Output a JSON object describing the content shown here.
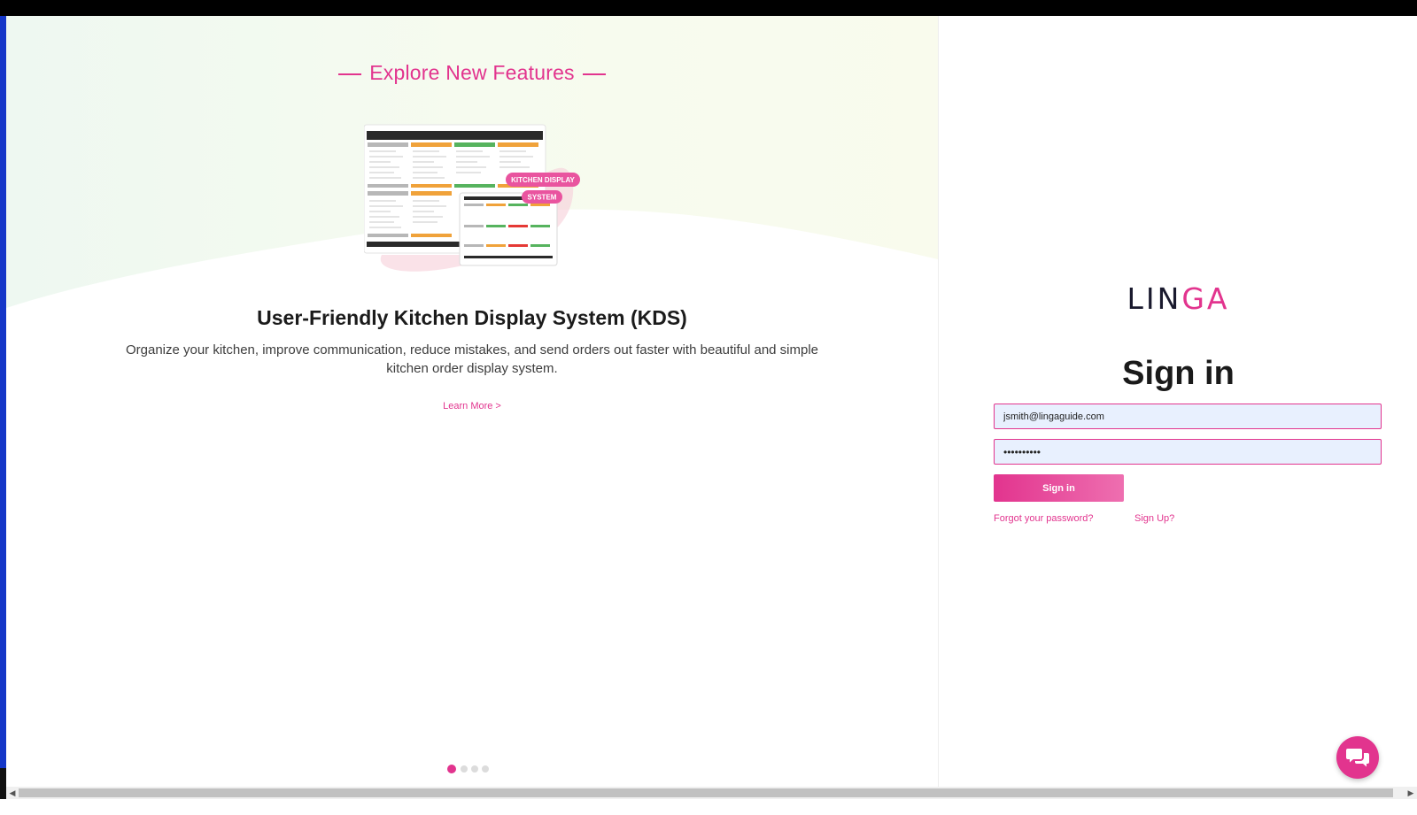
{
  "promo": {
    "section_heading": "Explore New Features",
    "image_badge_1": "KITCHEN DISPLAY",
    "image_badge_2": "SYSTEM",
    "title": "User-Friendly Kitchen Display System (KDS)",
    "description": "Organize your kitchen, improve communication, reduce mistakes, and send orders out faster with beautiful and simple kitchen order display system.",
    "learn_more": "Learn More >",
    "carousel": {
      "slide_count": 4,
      "active_index": 0
    }
  },
  "login": {
    "logo_main": "LIN",
    "logo_accent": "GA",
    "title": "Sign in",
    "email_value": "jsmith@lingaguide.com",
    "password_value": "••••••••••",
    "submit_label": "Sign in",
    "forgot_password": "Forgot your password?",
    "sign_up": "Sign Up?"
  },
  "icons": {
    "chat": "chat-bubbles-icon",
    "scroll_left": "chevron-left-icon",
    "scroll_right": "chevron-right-icon"
  },
  "colors": {
    "brand_pink": "#e2348e",
    "autofill_bg": "#e8f0fe"
  }
}
